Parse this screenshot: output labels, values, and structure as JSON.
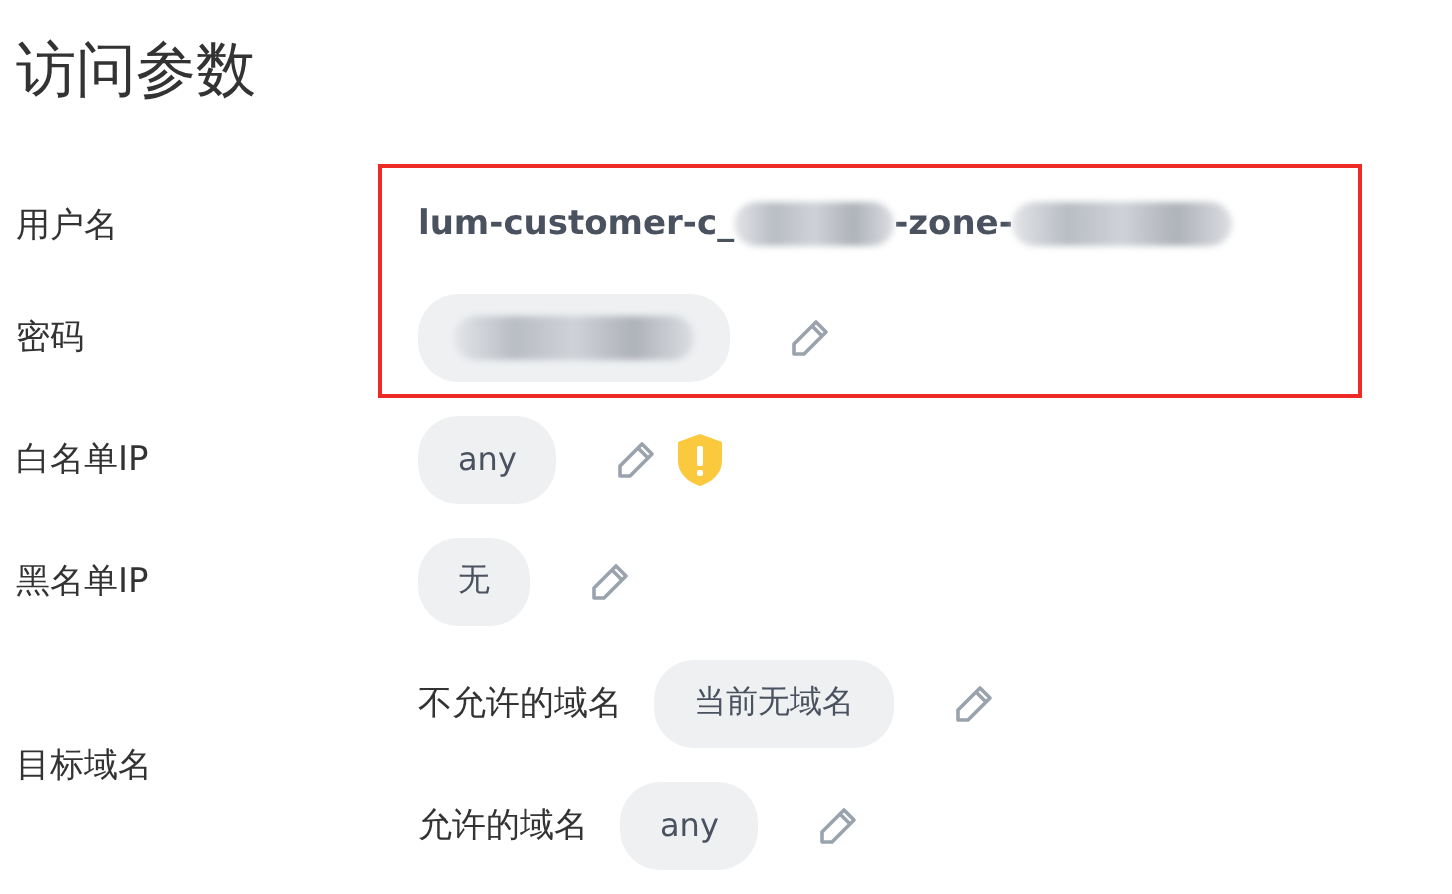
{
  "title": "访问参数",
  "credentials": {
    "highlighted": true,
    "rows": [
      {
        "label": "用户名",
        "kind": "username",
        "parts": [
          {
            "kind": "text",
            "text": "lum-customer-c_"
          },
          {
            "kind": "redacted"
          },
          {
            "kind": "text",
            "text": "-zone-"
          },
          {
            "kind": "redacted"
          }
        ]
      },
      {
        "label": "密码",
        "kind": "secret",
        "editable": true
      }
    ]
  },
  "rows": [
    {
      "label": "白名单IP",
      "kind": "pill",
      "value": "any",
      "editable": true,
      "warning": true
    },
    {
      "label": "黑名单IP",
      "kind": "pill",
      "value": "无",
      "editable": true,
      "warning": false
    },
    {
      "label": "目标域名",
      "kind": "domains",
      "entries": [
        {
          "label": "不允许的域名",
          "value": "当前无域名",
          "editable": true
        },
        {
          "label": "允许的域名",
          "value": "any",
          "editable": true
        }
      ]
    }
  ]
}
